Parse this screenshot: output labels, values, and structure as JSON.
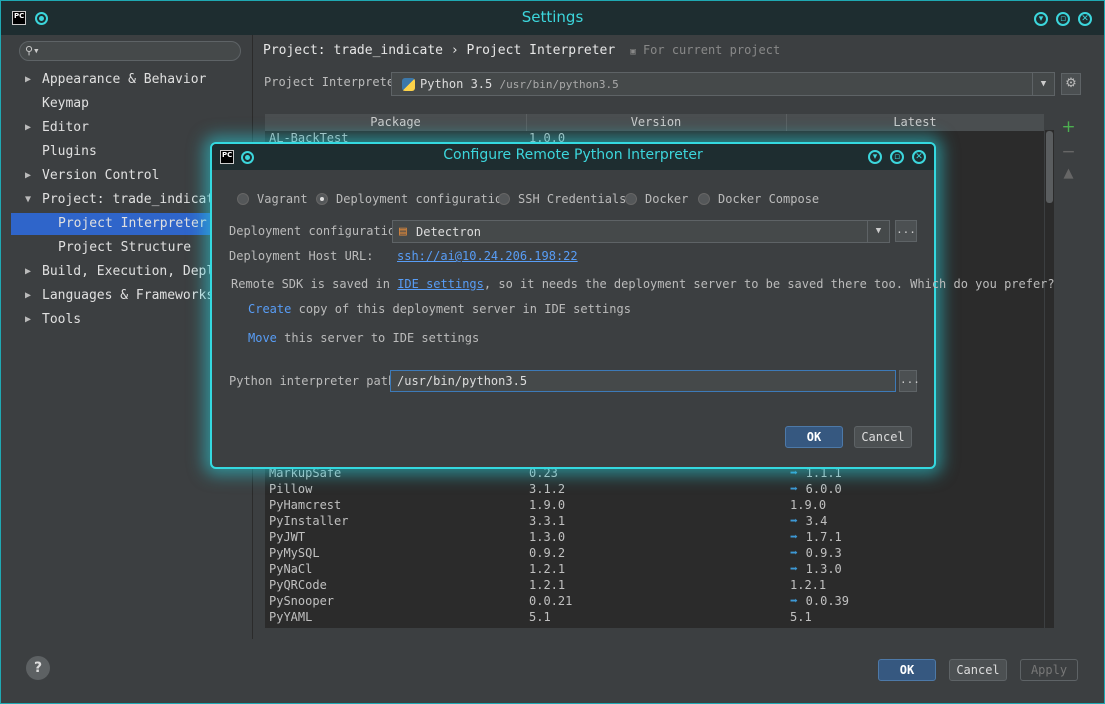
{
  "window": {
    "title": "Settings"
  },
  "search": {
    "placeholder": ""
  },
  "sidebar": {
    "items": [
      {
        "label": "Appearance & Behavior"
      },
      {
        "label": "Keymap"
      },
      {
        "label": "Editor"
      },
      {
        "label": "Plugins"
      },
      {
        "label": "Version Control"
      },
      {
        "label": "Project: trade_indicate"
      },
      {
        "label": "Project Interpreter"
      },
      {
        "label": "Project Structure"
      },
      {
        "label": "Build, Execution, Deploy"
      },
      {
        "label": "Languages & Frameworks"
      },
      {
        "label": "Tools"
      }
    ]
  },
  "breadcrumb": {
    "project": "Project: trade_indicate",
    "separator": "›",
    "page": "Project Interpreter",
    "note": "For current project"
  },
  "interpreter": {
    "label": "Project Interpreter:",
    "name": "Python 3.5",
    "path": "/usr/bin/python3.5"
  },
  "table": {
    "headers": [
      "Package",
      "Version",
      "Latest"
    ],
    "top_row": {
      "package": "AL-BackTest",
      "version": "1.0.0",
      "latest": ""
    },
    "rows": [
      {
        "package": "MarkupSafe",
        "version": "0.23",
        "latest": "1.1.1",
        "upgrade": true
      },
      {
        "package": "Pillow",
        "version": "3.1.2",
        "latest": "6.0.0",
        "upgrade": true
      },
      {
        "package": "PyHamcrest",
        "version": "1.9.0",
        "latest": "1.9.0",
        "upgrade": false
      },
      {
        "package": "PyInstaller",
        "version": "3.3.1",
        "latest": "3.4",
        "upgrade": true
      },
      {
        "package": "PyJWT",
        "version": "1.3.0",
        "latest": "1.7.1",
        "upgrade": true
      },
      {
        "package": "PyMySQL",
        "version": "0.9.2",
        "latest": "0.9.3",
        "upgrade": true
      },
      {
        "package": "PyNaCl",
        "version": "1.2.1",
        "latest": "1.3.0",
        "upgrade": true
      },
      {
        "package": "PyQRCode",
        "version": "1.2.1",
        "latest": "1.2.1",
        "upgrade": false
      },
      {
        "package": "PySnooper",
        "version": "0.0.21",
        "latest": "0.0.39",
        "upgrade": true
      },
      {
        "package": "PyYAML",
        "version": "5.1",
        "latest": "5.1",
        "upgrade": false
      }
    ]
  },
  "buttons": {
    "ok": "OK",
    "cancel": "Cancel",
    "apply": "Apply",
    "help": "?"
  },
  "dialog": {
    "title": "Configure Remote Python Interpreter",
    "radios": [
      "Vagrant",
      "Deployment configuration",
      "SSH Credentials",
      "Docker",
      "Docker Compose"
    ],
    "selected_radio": "Deployment configuration",
    "deploy_config_label": "Deployment configuration:",
    "deploy_config_value": "Detectron",
    "host_url_label": "Deployment Host URL:",
    "host_url_value": "ssh://ai@10.24.206.198:22",
    "sdk_msg_pre": "Remote SDK is saved in",
    "sdk_msg_link": "IDE settings",
    "sdk_msg_post": ", so it needs the deployment server to be saved there too. Which do you prefer?",
    "create_link": "Create",
    "create_text": "copy of this deployment server in IDE settings",
    "move_link": "Move",
    "move_text": "this server to IDE settings",
    "path_label": "Python interpreter path:",
    "path_value": "/usr/bin/python3.5",
    "ok": "OK",
    "cancel": "Cancel",
    "browse": "..."
  }
}
